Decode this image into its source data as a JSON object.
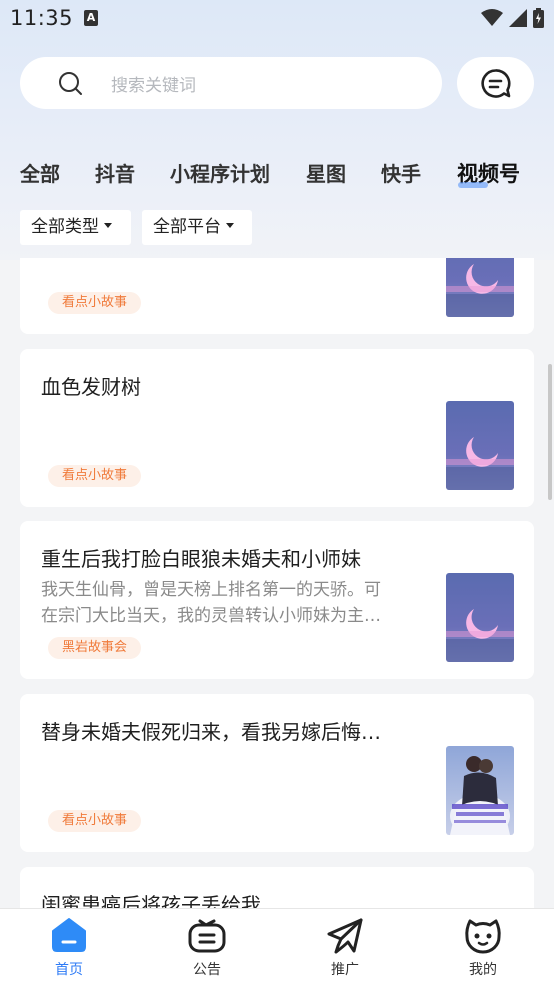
{
  "status_bar": {
    "time": "11:35",
    "notification_badge": "A"
  },
  "search": {
    "placeholder": "搜索关键词"
  },
  "tabs": [
    {
      "label": "全部"
    },
    {
      "label": "抖音"
    },
    {
      "label": "小程序计划"
    },
    {
      "label": "星图"
    },
    {
      "label": "快手"
    },
    {
      "label": "视频号",
      "active": true
    }
  ],
  "filters": [
    {
      "label": "全部类型"
    },
    {
      "label": "全部平台"
    }
  ],
  "cards": [
    {
      "title": "",
      "desc": [],
      "tag": "看点小故事",
      "cover": "moon"
    },
    {
      "title": "血色发财树",
      "desc": [],
      "tag": "看点小故事",
      "cover": "moon"
    },
    {
      "title": "重生后我打脸白眼狼未婚夫和小师妹",
      "desc": [
        "我天生仙骨，曾是天榜上排名第一的天骄。可",
        "在宗门大比当天，我的灵兽转认小师妹为主…"
      ],
      "tag": "黑岩故事会",
      "cover": "moon"
    },
    {
      "title": "替身未婚夫假死归来，看我另嫁后悔…",
      "desc": [],
      "tag": "看点小故事",
      "cover": "wedding"
    },
    {
      "title": "闺蜜患癌后将孩子丢给我",
      "desc": [],
      "tag": "",
      "cover": ""
    }
  ],
  "bottom_nav": [
    {
      "label": "首页",
      "icon": "home-icon",
      "active": true
    },
    {
      "label": "公告",
      "icon": "announcement-icon"
    },
    {
      "label": "推广",
      "icon": "promote-icon"
    },
    {
      "label": "我的",
      "icon": "profile-icon"
    }
  ],
  "colors": {
    "accent": "#2e7bf6",
    "tag_text": "#f07a3a",
    "tag_bg": "#fdf0e8"
  }
}
